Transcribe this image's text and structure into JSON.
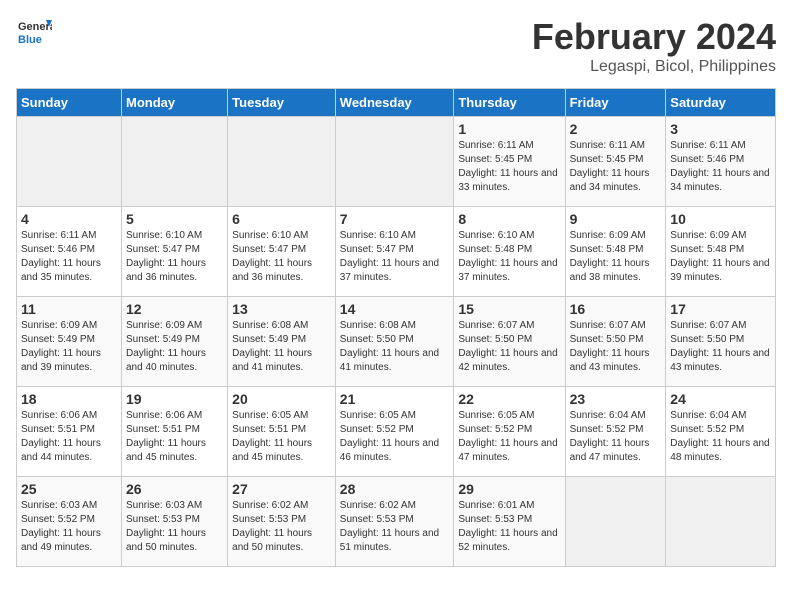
{
  "logo": {
    "line1": "General",
    "line2": "Blue"
  },
  "title": "February 2024",
  "subtitle": "Legaspi, Bicol, Philippines",
  "days_of_week": [
    "Sunday",
    "Monday",
    "Tuesday",
    "Wednesday",
    "Thursday",
    "Friday",
    "Saturday"
  ],
  "weeks": [
    [
      {
        "day": "",
        "info": ""
      },
      {
        "day": "",
        "info": ""
      },
      {
        "day": "",
        "info": ""
      },
      {
        "day": "",
        "info": ""
      },
      {
        "day": "1",
        "info": "Sunrise: 6:11 AM\nSunset: 5:45 PM\nDaylight: 11 hours and 33 minutes."
      },
      {
        "day": "2",
        "info": "Sunrise: 6:11 AM\nSunset: 5:45 PM\nDaylight: 11 hours and 34 minutes."
      },
      {
        "day": "3",
        "info": "Sunrise: 6:11 AM\nSunset: 5:46 PM\nDaylight: 11 hours and 34 minutes."
      }
    ],
    [
      {
        "day": "4",
        "info": "Sunrise: 6:11 AM\nSunset: 5:46 PM\nDaylight: 11 hours and 35 minutes."
      },
      {
        "day": "5",
        "info": "Sunrise: 6:10 AM\nSunset: 5:47 PM\nDaylight: 11 hours and 36 minutes."
      },
      {
        "day": "6",
        "info": "Sunrise: 6:10 AM\nSunset: 5:47 PM\nDaylight: 11 hours and 36 minutes."
      },
      {
        "day": "7",
        "info": "Sunrise: 6:10 AM\nSunset: 5:47 PM\nDaylight: 11 hours and 37 minutes."
      },
      {
        "day": "8",
        "info": "Sunrise: 6:10 AM\nSunset: 5:48 PM\nDaylight: 11 hours and 37 minutes."
      },
      {
        "day": "9",
        "info": "Sunrise: 6:09 AM\nSunset: 5:48 PM\nDaylight: 11 hours and 38 minutes."
      },
      {
        "day": "10",
        "info": "Sunrise: 6:09 AM\nSunset: 5:48 PM\nDaylight: 11 hours and 39 minutes."
      }
    ],
    [
      {
        "day": "11",
        "info": "Sunrise: 6:09 AM\nSunset: 5:49 PM\nDaylight: 11 hours and 39 minutes."
      },
      {
        "day": "12",
        "info": "Sunrise: 6:09 AM\nSunset: 5:49 PM\nDaylight: 11 hours and 40 minutes."
      },
      {
        "day": "13",
        "info": "Sunrise: 6:08 AM\nSunset: 5:49 PM\nDaylight: 11 hours and 41 minutes."
      },
      {
        "day": "14",
        "info": "Sunrise: 6:08 AM\nSunset: 5:50 PM\nDaylight: 11 hours and 41 minutes."
      },
      {
        "day": "15",
        "info": "Sunrise: 6:07 AM\nSunset: 5:50 PM\nDaylight: 11 hours and 42 minutes."
      },
      {
        "day": "16",
        "info": "Sunrise: 6:07 AM\nSunset: 5:50 PM\nDaylight: 11 hours and 43 minutes."
      },
      {
        "day": "17",
        "info": "Sunrise: 6:07 AM\nSunset: 5:50 PM\nDaylight: 11 hours and 43 minutes."
      }
    ],
    [
      {
        "day": "18",
        "info": "Sunrise: 6:06 AM\nSunset: 5:51 PM\nDaylight: 11 hours and 44 minutes."
      },
      {
        "day": "19",
        "info": "Sunrise: 6:06 AM\nSunset: 5:51 PM\nDaylight: 11 hours and 45 minutes."
      },
      {
        "day": "20",
        "info": "Sunrise: 6:05 AM\nSunset: 5:51 PM\nDaylight: 11 hours and 45 minutes."
      },
      {
        "day": "21",
        "info": "Sunrise: 6:05 AM\nSunset: 5:52 PM\nDaylight: 11 hours and 46 minutes."
      },
      {
        "day": "22",
        "info": "Sunrise: 6:05 AM\nSunset: 5:52 PM\nDaylight: 11 hours and 47 minutes."
      },
      {
        "day": "23",
        "info": "Sunrise: 6:04 AM\nSunset: 5:52 PM\nDaylight: 11 hours and 47 minutes."
      },
      {
        "day": "24",
        "info": "Sunrise: 6:04 AM\nSunset: 5:52 PM\nDaylight: 11 hours and 48 minutes."
      }
    ],
    [
      {
        "day": "25",
        "info": "Sunrise: 6:03 AM\nSunset: 5:52 PM\nDaylight: 11 hours and 49 minutes."
      },
      {
        "day": "26",
        "info": "Sunrise: 6:03 AM\nSunset: 5:53 PM\nDaylight: 11 hours and 50 minutes."
      },
      {
        "day": "27",
        "info": "Sunrise: 6:02 AM\nSunset: 5:53 PM\nDaylight: 11 hours and 50 minutes."
      },
      {
        "day": "28",
        "info": "Sunrise: 6:02 AM\nSunset: 5:53 PM\nDaylight: 11 hours and 51 minutes."
      },
      {
        "day": "29",
        "info": "Sunrise: 6:01 AM\nSunset: 5:53 PM\nDaylight: 11 hours and 52 minutes."
      },
      {
        "day": "",
        "info": ""
      },
      {
        "day": "",
        "info": ""
      }
    ]
  ]
}
